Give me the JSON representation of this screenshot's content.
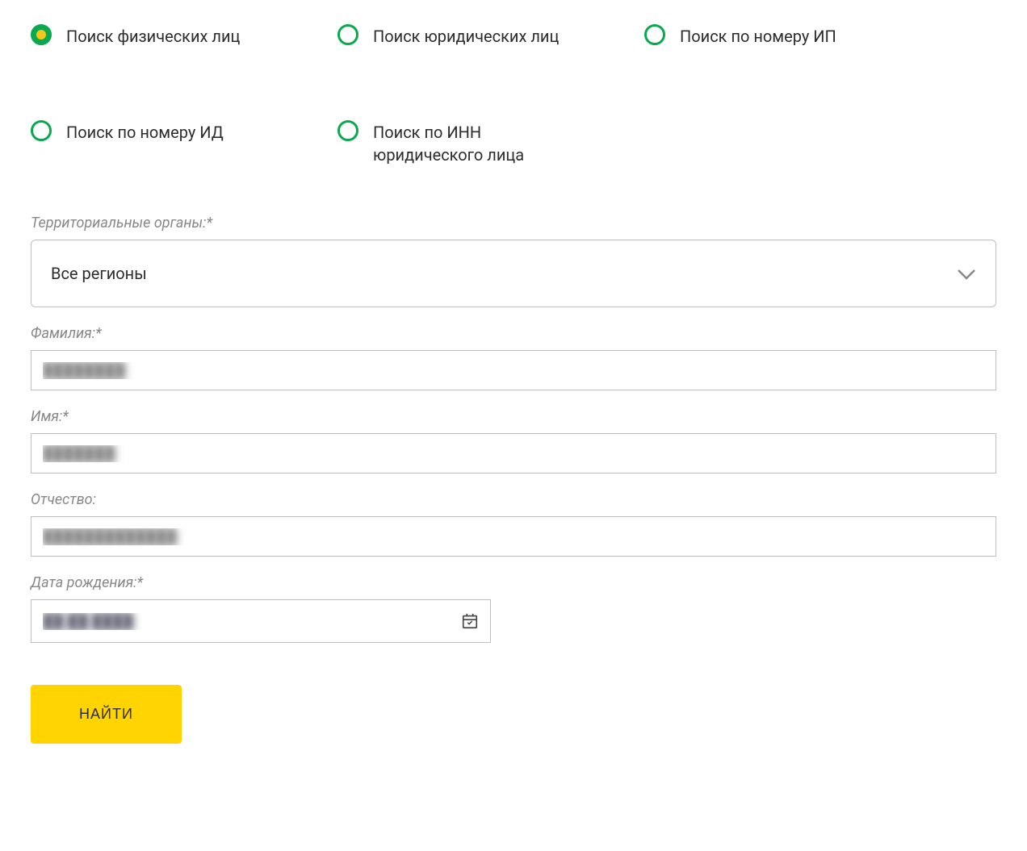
{
  "searchTypes": {
    "option1": {
      "label": "Поиск физических лиц",
      "selected": true
    },
    "option2": {
      "label": "Поиск юридических лиц",
      "selected": false
    },
    "option3": {
      "label": "Поиск по номеру ИП",
      "selected": false
    },
    "option4": {
      "label": "Поиск по номеру ИД",
      "selected": false
    },
    "option5": {
      "label": "Поиск по ИНН юридического лица",
      "selected": false
    }
  },
  "form": {
    "region": {
      "label": "Территориальные органы:*",
      "value": "Все регионы"
    },
    "lastName": {
      "label": "Фамилия:*",
      "value": "████████"
    },
    "firstName": {
      "label": "Имя:*",
      "value": "███████"
    },
    "patronymic": {
      "label": "Отчество:",
      "value": "█████████████"
    },
    "birthDate": {
      "label": "Дата рождения:*",
      "value": "██.██.████"
    },
    "submit": "НАЙТИ"
  }
}
